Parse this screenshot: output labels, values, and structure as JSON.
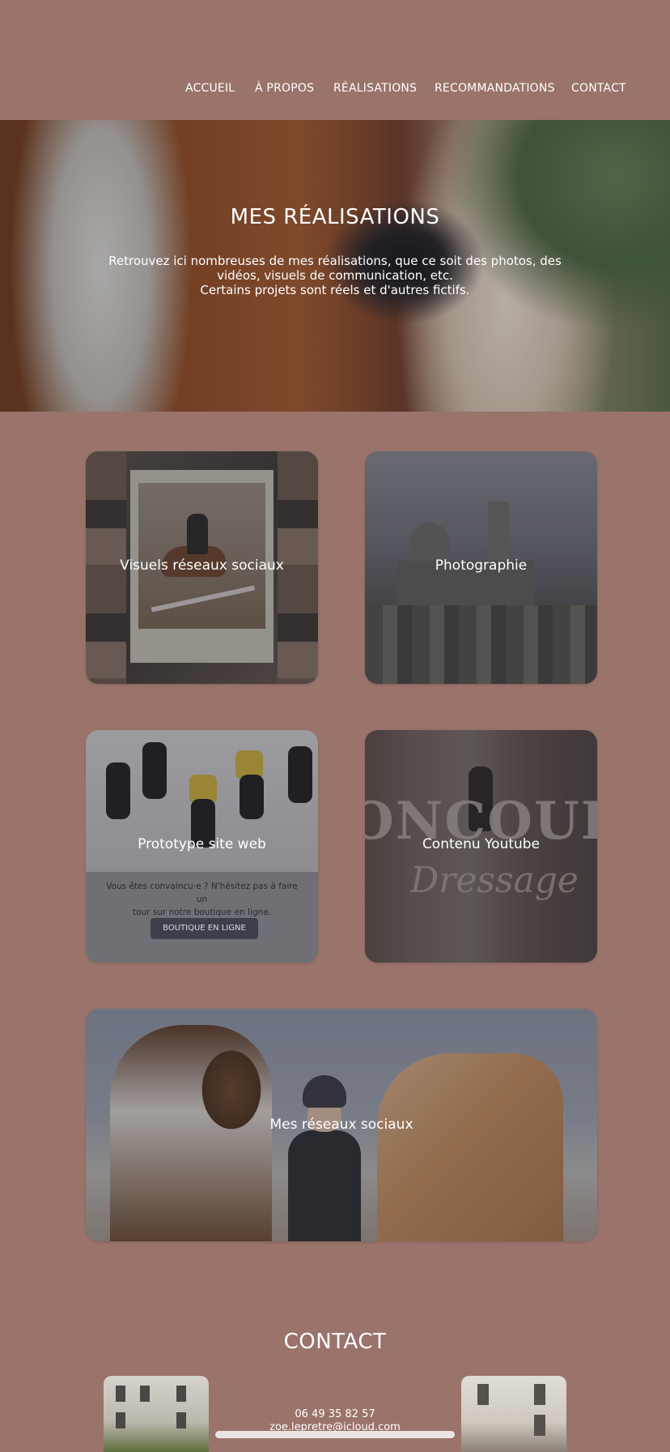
{
  "nav": {
    "items": [
      "ACCUEIL",
      "À PROPOS",
      "RÉALISATIONS",
      "RECOMMANDATIONS",
      "CONTACT"
    ]
  },
  "hero": {
    "title": "MES RÉALISATIONS",
    "text_line1": "Retrouvez ici nombreuses de mes réalisations, que ce soit des photos, des",
    "text_line2": "vidéos, visuels de communication, etc.",
    "text_line3": "Certains projets sont réels et d'autres fictifs."
  },
  "cards": {
    "social_visuals": "Visuels réseaux sociaux",
    "photography": "Photographie",
    "website": {
      "label": "Prototype site web",
      "text_line1": "Vous êtes convaincu·e ? N'hésitez pas à faire un",
      "text_line2": "tour sur notre boutique en ligne.",
      "button": "BOUTIQUE EN LIGNE"
    },
    "youtube": {
      "label": "Contenu Youtube",
      "overlay_word1": "ONCOUR",
      "overlay_word2": "Dressage"
    },
    "social_networks": "Mes réseaux sociaux"
  },
  "contact": {
    "title": "CONTACT",
    "phone": "06 49 35 82 57",
    "email": "zoe.lepretre@icloud.com"
  },
  "colors": {
    "background": "#9a736b",
    "text": "#ffffff",
    "button": "#3d3f4a"
  }
}
